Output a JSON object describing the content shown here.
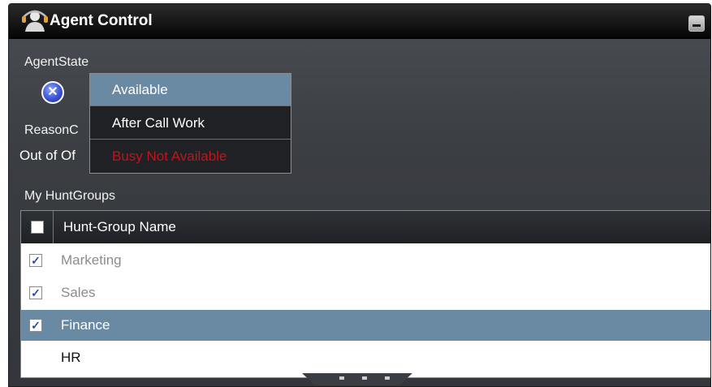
{
  "window": {
    "title": "Agent Control",
    "icon": "agent-icon",
    "minimize_icon": "minimize-icon"
  },
  "agent_state": {
    "label": "AgentState",
    "status_icon": "x-circle-icon",
    "status_glyph": "✕"
  },
  "reason_code": {
    "label": "ReasonC",
    "value": "Out of Of"
  },
  "dropdown": {
    "items": [
      {
        "label": "Available",
        "state": "selected"
      },
      {
        "label": "After Call Work",
        "state": "normal"
      },
      {
        "label": "Busy Not Available",
        "state": "disabled"
      }
    ],
    "colors": {
      "selected": "#6a8aa3",
      "disabled_text": "#c0141c"
    }
  },
  "hunt_groups": {
    "label": "My HuntGroups",
    "column_header": "Hunt-Group Name",
    "rows": [
      {
        "name": "Marketing",
        "checked": true,
        "selected": false
      },
      {
        "name": "Sales",
        "checked": true,
        "selected": false
      },
      {
        "name": "Finance",
        "checked": true,
        "selected": true
      },
      {
        "name": "HR",
        "checked": false,
        "selected": false
      }
    ]
  },
  "resize_grip_icon": "resize-grip-icon"
}
